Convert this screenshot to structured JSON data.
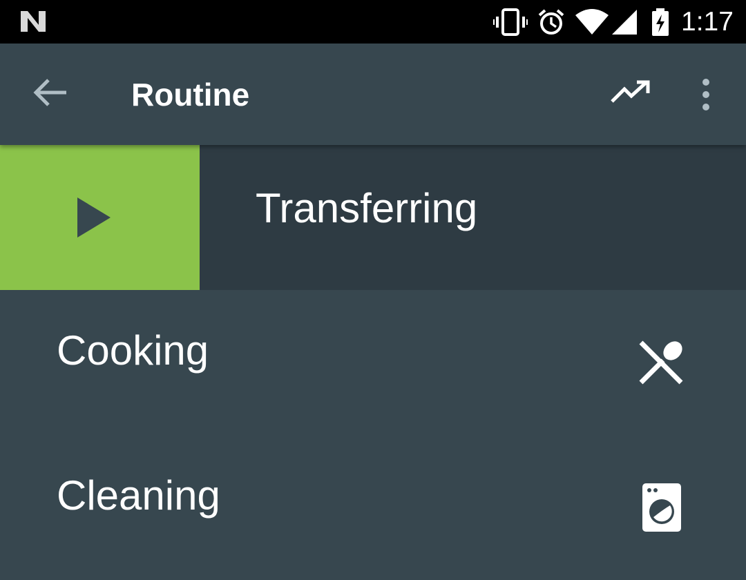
{
  "status_bar": {
    "time": "1:17",
    "icons": [
      "notification-n-icon",
      "vibrate-icon",
      "alarm-icon",
      "wifi-icon",
      "signal-icon",
      "battery-charging-icon"
    ]
  },
  "app_bar": {
    "title": "Routine",
    "icons": [
      "back-arrow-icon",
      "trending-up-icon",
      "more-vert-icon"
    ]
  },
  "active_activity": {
    "label": "Transferring",
    "icon": "play-icon",
    "accent_color": "#8bc34a"
  },
  "activities": [
    {
      "label": "Cooking",
      "icon": "cutlery-icon"
    },
    {
      "label": "Cleaning",
      "icon": "washing-machine-icon"
    }
  ],
  "colors": {
    "status_bar": "#000000",
    "app_bar": "#37474f",
    "active_row": "#2e3b43",
    "background": "#37474f",
    "text": "#ffffff"
  }
}
